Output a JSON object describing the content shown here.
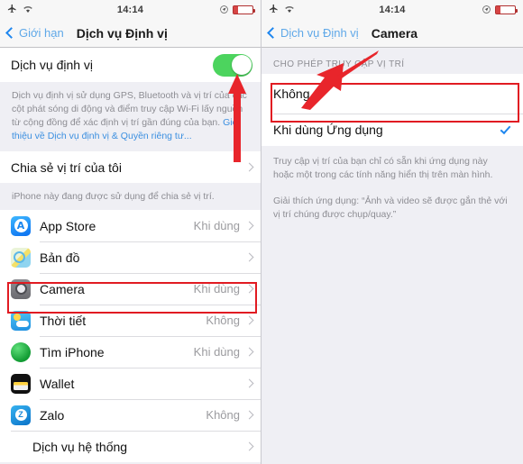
{
  "left_screen": {
    "statusbar": {
      "airplane_icon": "airplane-icon",
      "wifi_icon": "wifi-icon",
      "time": "14:14",
      "location_icon": "location-arrow-icon",
      "battery_icon": "battery-low-icon"
    },
    "navbar": {
      "back_label": "Giới hạn",
      "title": "Dịch vụ Định vị"
    },
    "master_toggle": {
      "label": "Dịch vụ định vị",
      "state": "on"
    },
    "description": "Dịch vụ định vị sử dụng GPS, Bluetooth và vị trí của các cột phát sóng di động và điểm truy cập Wi-Fi lấy nguồn từ cộng đồng để xác định vị trí gần đúng của bạn. ",
    "description_link": "Giới thiệu về Dịch vụ định vị & Quyền riêng tư...",
    "share_row": {
      "label": "Chia sẻ vị trí của tôi"
    },
    "share_note": "iPhone này đang được sử dụng để chia sẻ vị trí.",
    "apps": [
      {
        "icon": "app-store-icon",
        "name": "App Store",
        "value": "Khi dùng"
      },
      {
        "icon": "maps-icon",
        "name": "Bản đồ",
        "value": ""
      },
      {
        "icon": "camera-icon",
        "name": "Camera",
        "value": "Khi dùng"
      },
      {
        "icon": "weather-icon",
        "name": "Thời tiết",
        "value": "Không"
      },
      {
        "icon": "find-iphone-icon",
        "name": "Tìm iPhone",
        "value": "Khi dùng"
      },
      {
        "icon": "wallet-icon",
        "name": "Wallet",
        "value": ""
      },
      {
        "icon": "zalo-icon",
        "name": "Zalo",
        "value": "Không"
      }
    ],
    "system_services": {
      "label": "Dịch vụ hệ thống"
    }
  },
  "right_screen": {
    "statusbar": {
      "airplane_icon": "airplane-icon",
      "wifi_icon": "wifi-icon",
      "time": "14:14",
      "location_icon": "location-arrow-icon",
      "battery_icon": "battery-low-icon"
    },
    "navbar": {
      "back_label": "Dịch vụ Định vị",
      "title": "Camera"
    },
    "section_header": "CHO PHÉP TRUY CẬP VỊ TRÍ",
    "options": [
      {
        "label": "Không",
        "selected": false
      },
      {
        "label": "Khi dùng Ứng dụng",
        "selected": true
      }
    ],
    "footer_note_1": "Truy cập vị trí của bạn chỉ có sẵn khi ứng dụng này hoặc một trong các tính năng hiển thị trên màn hình.",
    "footer_note_2": "Giải thích ứng dụng: “Ảnh và video sẽ được gắn thẻ với vị trí chúng được chụp/quay.”"
  },
  "annotations": {
    "highlight_color": "#e11b22",
    "camera_row_box": "red-highlight-camera-row",
    "khong_row_box": "red-highlight-khong-row",
    "up_arrow": "red-up-arrow",
    "diagonal_arrow": "red-diagonal-arrow"
  }
}
